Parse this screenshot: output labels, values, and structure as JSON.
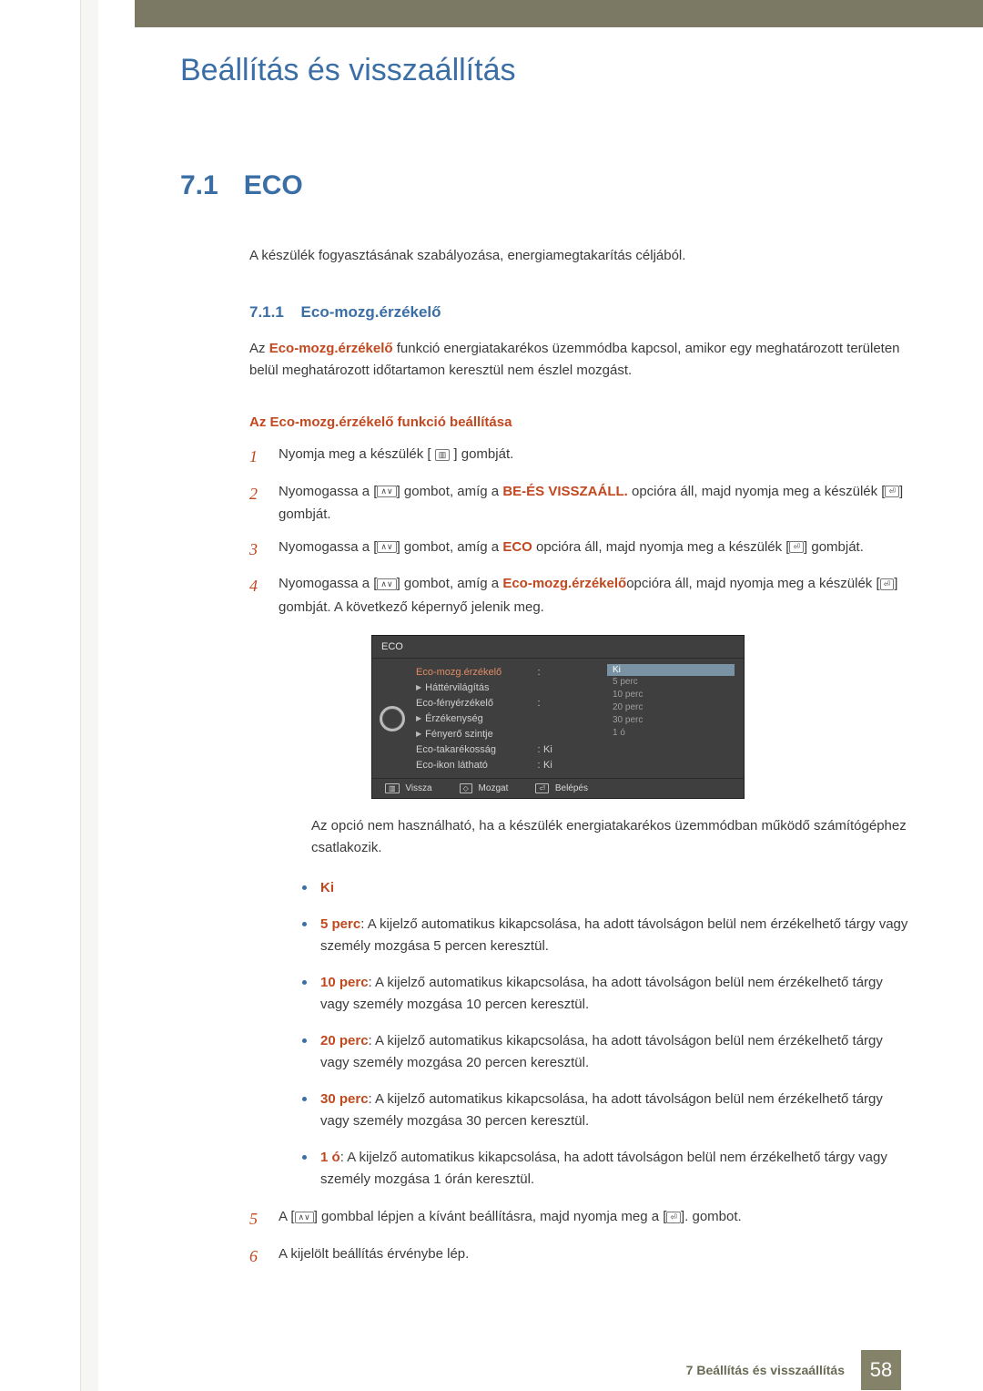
{
  "page_title": "Beállítás és visszaállítás",
  "section": {
    "number": "7.1",
    "title": "ECO"
  },
  "intro": "A készülék fogyasztásának szabályozása, energiamegtakarítás céljából.",
  "subsection": {
    "number": "7.1.1",
    "title": "Eco-mozg.érzékelő"
  },
  "subsection_para": {
    "lead_kw": "Eco-mozg.érzékelő",
    "before": "Az ",
    "after": " funkció energiatakarékos üzemmódba kapcsol, amikor egy meghatározott területen belül meghatározott időtartamon keresztül nem észlel mozgást."
  },
  "how_to_heading": "Az Eco-mozg.érzékelő funkció beállítása",
  "icons": {
    "menu": "▥",
    "updown": "∧∨",
    "enter": "⏎",
    "move": "◇"
  },
  "steps": [
    {
      "n": "1",
      "parts": [
        {
          "t": "Nyomja meg a készülék [ "
        },
        {
          "icon": "menu"
        },
        {
          "t": " ] gombját."
        }
      ]
    },
    {
      "n": "2",
      "parts": [
        {
          "t": "Nyomogassa a ["
        },
        {
          "icon": "updown"
        },
        {
          "t": "] gombot, amíg a "
        },
        {
          "kw": "BE-ÉS VISSZAÁLL."
        },
        {
          "t": " opcióra áll, majd nyomja meg a készülék ["
        },
        {
          "icon": "enter"
        },
        {
          "t": "] gombját."
        }
      ]
    },
    {
      "n": "3",
      "parts": [
        {
          "t": "Nyomogassa a ["
        },
        {
          "icon": "updown"
        },
        {
          "t": "] gombot, amíg a "
        },
        {
          "kw": "ECO"
        },
        {
          "t": " opcióra áll, majd nyomja meg a készülék ["
        },
        {
          "icon": "enter"
        },
        {
          "t": "] gombját."
        }
      ]
    },
    {
      "n": "4",
      "parts": [
        {
          "t": "Nyomogassa a ["
        },
        {
          "icon": "updown"
        },
        {
          "t": "] gombot, amíg a "
        },
        {
          "kw": "Eco-mozg.érzékelő"
        },
        {
          "t": "opcióra áll, majd nyomja meg a készülék ["
        },
        {
          "icon": "enter"
        },
        {
          "t": "] gombját. A következő képernyő jelenik meg."
        }
      ]
    }
  ],
  "osd": {
    "title": "ECO",
    "items": [
      {
        "label": "Eco-mozg.érzékelő",
        "active": true,
        "arrow": false,
        "colon": ":"
      },
      {
        "label": "Háttérvilágítás",
        "arrow": true
      },
      {
        "label": "Eco-fényérzékelő",
        "colon": ":"
      },
      {
        "label": "Érzékenység",
        "arrow": true
      },
      {
        "label": "Fényerő szintje",
        "arrow": true
      },
      {
        "label": "Eco-takarékosság",
        "colon": ":",
        "val": "Ki"
      },
      {
        "label": "Eco-ikon látható",
        "colon": ":",
        "val": "Ki"
      }
    ],
    "dropdown": {
      "selected": "Ki",
      "options": [
        "5 perc",
        "10 perc",
        "20 perc",
        "30 perc",
        "1 ó"
      ]
    },
    "bottom": [
      {
        "icon": "▥",
        "label": "Vissza"
      },
      {
        "icon": "◇",
        "label": "Mozgat"
      },
      {
        "icon": "⏎",
        "label": "Belépés"
      }
    ]
  },
  "osd_note": "Az opció nem használható, ha a készülék energiatakarékos üzemmódban működő számítógéphez csatlakozik.",
  "bullets": [
    {
      "kw": "Ki",
      "rest": ""
    },
    {
      "kw": "5 perc",
      "rest": ": A kijelző automatikus kikapcsolása, ha adott távolságon belül nem érzékelhető tárgy vagy személy mozgása 5 percen keresztül."
    },
    {
      "kw": "10 perc",
      "rest": ": A kijelző automatikus kikapcsolása, ha adott távolságon belül nem érzékelhető tárgy vagy személy mozgása 10 percen keresztül."
    },
    {
      "kw": "20 perc",
      "rest": ": A kijelző automatikus kikapcsolása, ha adott távolságon belül nem érzékelhető tárgy vagy személy mozgása 20 percen keresztül."
    },
    {
      "kw": "30 perc",
      "rest": ": A kijelző automatikus kikapcsolása, ha adott távolságon belül nem érzékelhető tárgy vagy személy mozgása 30 percen keresztül."
    },
    {
      "kw": "1 ó",
      "rest": ": A kijelző automatikus kikapcsolása, ha adott távolságon belül nem érzékelhető tárgy vagy személy mozgása 1 órán keresztül."
    }
  ],
  "steps_tail": [
    {
      "n": "5",
      "parts": [
        {
          "t": "A ["
        },
        {
          "icon": "updown"
        },
        {
          "t": "] gombbal lépjen a kívánt beállításra, majd nyomja meg a ["
        },
        {
          "icon": "enter"
        },
        {
          "t": "]. gombot."
        }
      ]
    },
    {
      "n": "6",
      "parts": [
        {
          "t": "A kijelölt beállítás érvénybe lép."
        }
      ]
    }
  ],
  "footer": {
    "crumb": "7 Beállítás és visszaállítás",
    "page": "58"
  }
}
